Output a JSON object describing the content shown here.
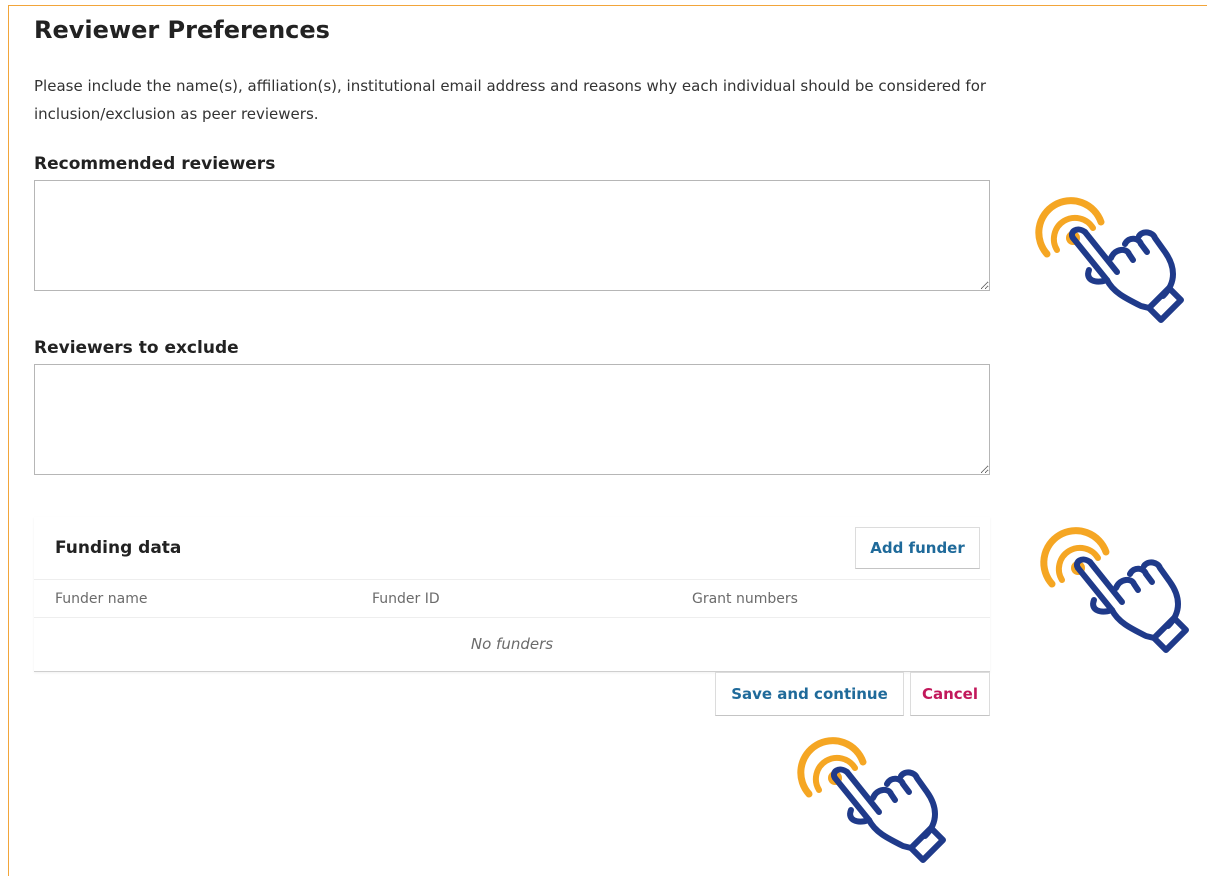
{
  "page": {
    "title": "Reviewer Preferences",
    "intro": "Please include the name(s), affiliation(s), institutional email address and reasons why each individual should be considered for inclusion/exclusion as peer reviewers."
  },
  "fields": {
    "recommended": {
      "label": "Recommended reviewers",
      "value": ""
    },
    "exclude": {
      "label": "Reviewers to exclude",
      "value": ""
    }
  },
  "funding": {
    "title": "Funding data",
    "add_button": "Add funder",
    "columns": [
      "Funder name",
      "Funder ID",
      "Grant numbers"
    ],
    "empty_message": "No funders"
  },
  "actions": {
    "save": "Save and continue",
    "cancel": "Cancel"
  },
  "colors": {
    "accent_blue": "#1f6a9a",
    "cancel_pink": "#c2185b",
    "frame_orange": "#f2a53a",
    "hand_navy": "#1f3a8a",
    "tap_orange": "#f5a623"
  },
  "icons": [
    "tap-hand-icon"
  ]
}
